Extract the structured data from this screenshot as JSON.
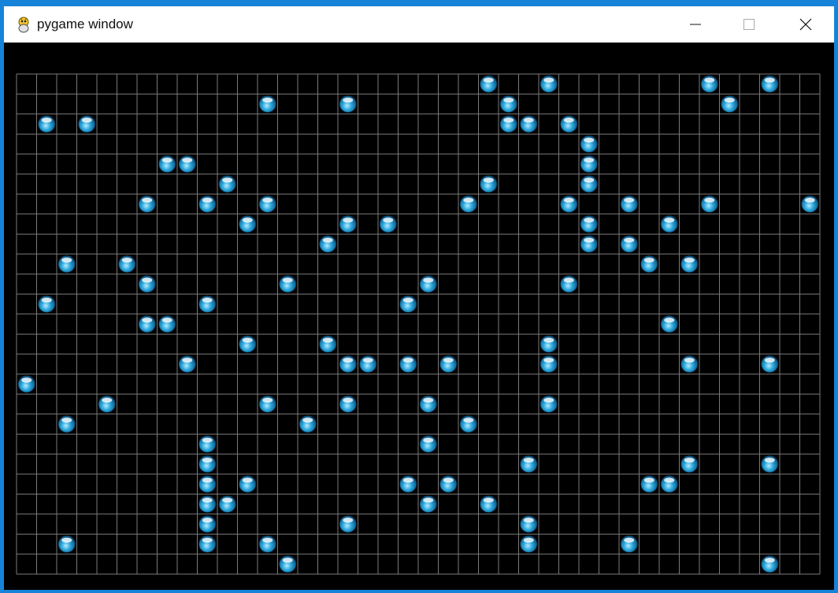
{
  "window": {
    "title": "pygame window",
    "icon": "snake-icon",
    "controls": [
      "minimize-icon",
      "maximize-icon",
      "close-icon"
    ]
  },
  "board": {
    "rows": 25,
    "cols": 40,
    "grid_color": "#7a7a7a",
    "background": "#000000",
    "ball_color": "#2aa7dc",
    "balls": [
      [
        0,
        23
      ],
      [
        0,
        26
      ],
      [
        0,
        34
      ],
      [
        0,
        37
      ],
      [
        1,
        12
      ],
      [
        1,
        16
      ],
      [
        1,
        24
      ],
      [
        1,
        35
      ],
      [
        2,
        1
      ],
      [
        2,
        3
      ],
      [
        2,
        24
      ],
      [
        2,
        25
      ],
      [
        2,
        27
      ],
      [
        3,
        28
      ],
      [
        4,
        7
      ],
      [
        4,
        8
      ],
      [
        4,
        28
      ],
      [
        5,
        10
      ],
      [
        5,
        23
      ],
      [
        5,
        28
      ],
      [
        6,
        6
      ],
      [
        6,
        9
      ],
      [
        6,
        12
      ],
      [
        6,
        22
      ],
      [
        6,
        27
      ],
      [
        6,
        30
      ],
      [
        6,
        34
      ],
      [
        6,
        39
      ],
      [
        7,
        11
      ],
      [
        7,
        16
      ],
      [
        7,
        18
      ],
      [
        7,
        28
      ],
      [
        7,
        32
      ],
      [
        8,
        15
      ],
      [
        8,
        28
      ],
      [
        8,
        30
      ],
      [
        9,
        2
      ],
      [
        9,
        5
      ],
      [
        9,
        31
      ],
      [
        9,
        33
      ],
      [
        10,
        6
      ],
      [
        10,
        13
      ],
      [
        10,
        20
      ],
      [
        10,
        27
      ],
      [
        11,
        1
      ],
      [
        11,
        9
      ],
      [
        11,
        19
      ],
      [
        12,
        6
      ],
      [
        12,
        7
      ],
      [
        12,
        32
      ],
      [
        13,
        11
      ],
      [
        13,
        15
      ],
      [
        13,
        26
      ],
      [
        14,
        8
      ],
      [
        14,
        16
      ],
      [
        14,
        17
      ],
      [
        14,
        19
      ],
      [
        14,
        21
      ],
      [
        14,
        26
      ],
      [
        14,
        33
      ],
      [
        14,
        37
      ],
      [
        15,
        0
      ],
      [
        16,
        4
      ],
      [
        16,
        12
      ],
      [
        16,
        16
      ],
      [
        16,
        20
      ],
      [
        16,
        26
      ],
      [
        17,
        2
      ],
      [
        17,
        14
      ],
      [
        17,
        22
      ],
      [
        18,
        9
      ],
      [
        18,
        20
      ],
      [
        19,
        9
      ],
      [
        19,
        25
      ],
      [
        19,
        33
      ],
      [
        19,
        37
      ],
      [
        20,
        9
      ],
      [
        20,
        11
      ],
      [
        20,
        19
      ],
      [
        20,
        21
      ],
      [
        20,
        31
      ],
      [
        20,
        32
      ],
      [
        21,
        9
      ],
      [
        21,
        10
      ],
      [
        21,
        20
      ],
      [
        21,
        23
      ],
      [
        22,
        9
      ],
      [
        22,
        16
      ],
      [
        22,
        25
      ],
      [
        23,
        2
      ],
      [
        23,
        9
      ],
      [
        23,
        12
      ],
      [
        23,
        25
      ],
      [
        23,
        30
      ],
      [
        24,
        13
      ],
      [
        24,
        37
      ]
    ]
  }
}
